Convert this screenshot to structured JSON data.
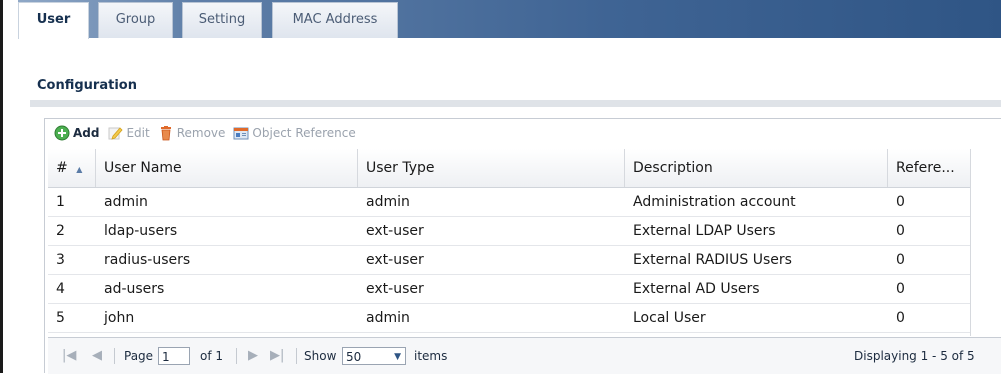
{
  "tabs": [
    {
      "label": "User",
      "active": true
    },
    {
      "label": "Group",
      "active": false
    },
    {
      "label": "Setting",
      "active": false
    },
    {
      "label": "MAC Address",
      "active": false
    }
  ],
  "section": {
    "title": "Configuration"
  },
  "toolbar": {
    "add": "Add",
    "edit": "Edit",
    "remove": "Remove",
    "object_reference": "Object Reference"
  },
  "table": {
    "columns": [
      "#",
      "User Name",
      "User Type",
      "Description",
      "Refere..."
    ],
    "sort_indicator": "▲",
    "rows": [
      [
        "1",
        "admin",
        "admin",
        "Administration account",
        "0"
      ],
      [
        "2",
        "ldap-users",
        "ext-user",
        "External LDAP Users",
        "0"
      ],
      [
        "3",
        "radius-users",
        "ext-user",
        "External RADIUS Users",
        "0"
      ],
      [
        "4",
        "ad-users",
        "ext-user",
        "External AD Users",
        "0"
      ],
      [
        "5",
        "john",
        "admin",
        "Local User",
        "0"
      ]
    ]
  },
  "pager": {
    "page_label": "Page",
    "page_value": "1",
    "of_label": "of 1",
    "show_label": "Show",
    "show_value": "50",
    "items_label": "items",
    "displaying": "Displaying 1 - 5 of 5"
  },
  "colors": {
    "tab_active_text": "#16304f",
    "add_icon": "#4caf50",
    "remove_icon": "#e06a2a"
  }
}
